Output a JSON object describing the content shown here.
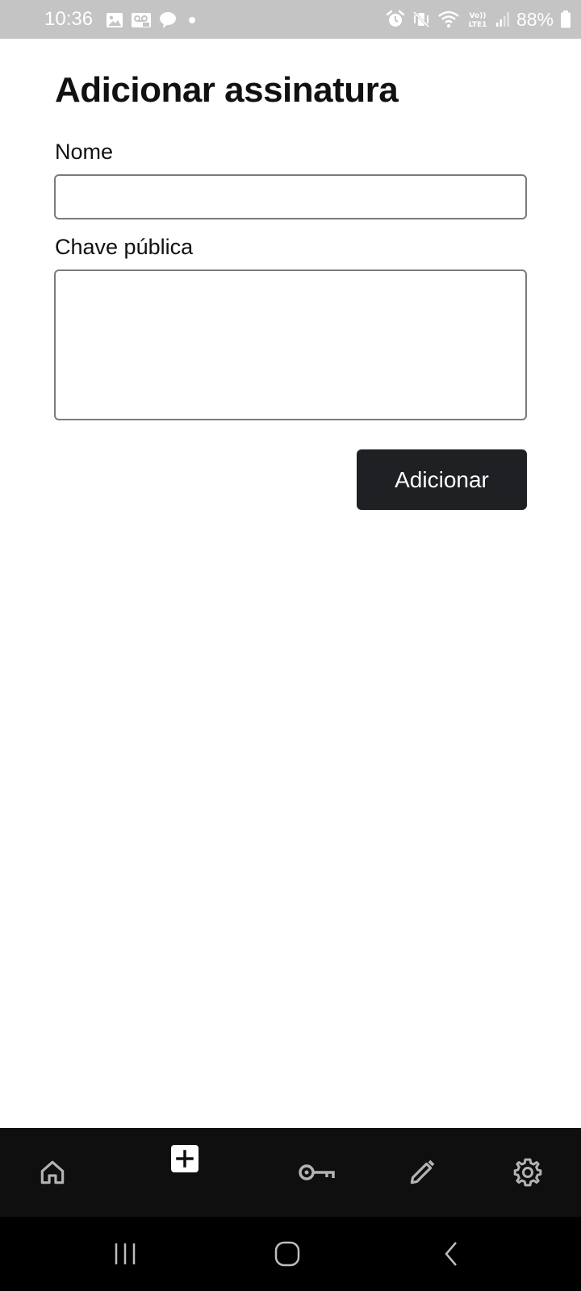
{
  "status_bar": {
    "time": "10:36",
    "battery": "88%",
    "left_icons": [
      "gallery-icon",
      "voicemail-icon",
      "chat-icon",
      "dot-icon"
    ],
    "right_icons": [
      "alarm-icon",
      "vibrate-icon",
      "wifi-icon",
      "volte-icon",
      "signal-icon",
      "battery-icon"
    ]
  },
  "form": {
    "title": "Adicionar assinatura",
    "name_label": "Nome",
    "name_value": "",
    "key_label": "Chave pública",
    "key_value": "",
    "submit_label": "Adicionar"
  },
  "bottom_nav": {
    "items": [
      {
        "icon": "home-icon",
        "active": false
      },
      {
        "icon": "add-icon",
        "active": true
      },
      {
        "icon": "key-icon",
        "active": false
      },
      {
        "icon": "pencil-icon",
        "active": false
      },
      {
        "icon": "gear-icon",
        "active": false
      }
    ]
  },
  "system_nav": {
    "buttons": [
      "recents-icon",
      "home-circle-icon",
      "back-icon"
    ]
  },
  "colors": {
    "status_bar_bg": "#c4c4c4",
    "button_bg": "#1e2024",
    "nav_bg": "#0f0f0f",
    "nav_icon": "#b3b3b3",
    "input_border": "#7b7b7b"
  }
}
